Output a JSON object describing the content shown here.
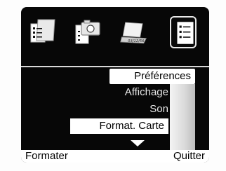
{
  "tabs": [
    {
      "icon": "document-icon",
      "active": false
    },
    {
      "icon": "camera-document-icon",
      "active": false
    },
    {
      "icon": "laptop-date-icon",
      "active": false,
      "date_text": "03/12/56"
    },
    {
      "icon": "checklist-icon",
      "active": true
    }
  ],
  "menu": {
    "title": "Préférences",
    "items": [
      {
        "label": "Affichage",
        "selected": false
      },
      {
        "label": "Son",
        "selected": false
      },
      {
        "label": "Format. Carte",
        "selected": true
      }
    ]
  },
  "softkeys": {
    "left": "Formater",
    "right": "Quitter"
  }
}
